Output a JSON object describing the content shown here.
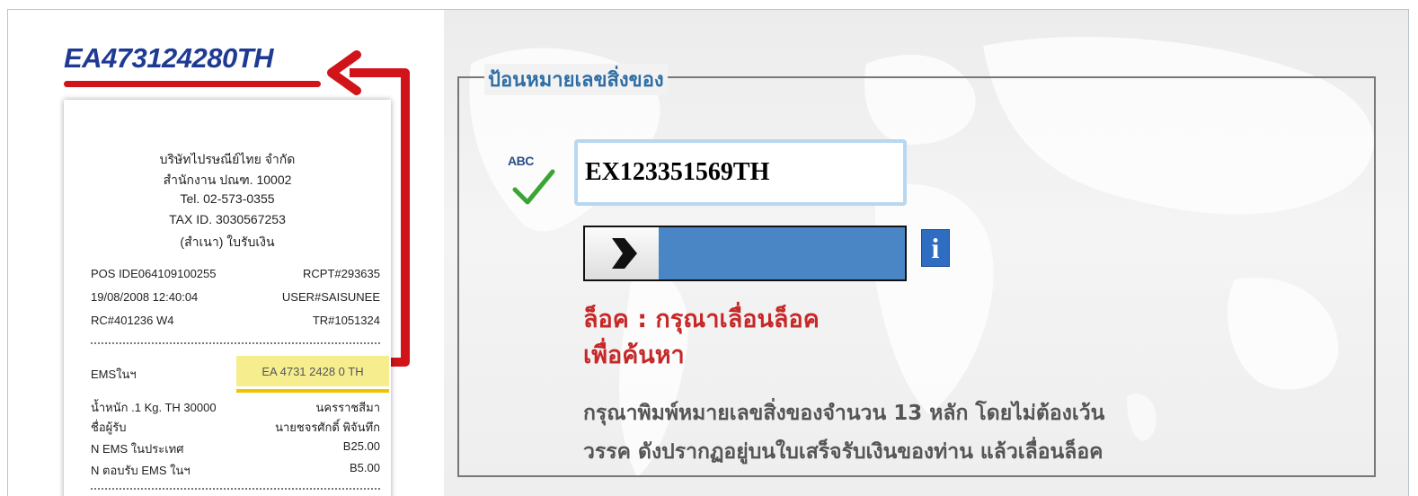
{
  "receipt_panel": {
    "tracking_heading": "EA473124280TH",
    "header_lines": [
      "บริษัทไปรษณีย์ไทย จำกัด",
      "สำนักงาน ปณฑ. 10002",
      "Tel. 02-573-0355",
      "TAX ID. 3030567253",
      "(สำเนา) ใบรับเงิน"
    ],
    "rows": [
      {
        "left": "POS IDE064109100255",
        "right": "RCPT#293635"
      },
      {
        "left": "19/08/2008  12:40:04",
        "right": "USER#SAISUNEE"
      },
      {
        "left": "RC#401236 W4",
        "right": "TR#1051324"
      }
    ],
    "service_label": "EMSในฯ",
    "tracking_highlight": "EA 4731 2428 0 TH",
    "detail_rows": [
      {
        "left": "น้ำหนัก .1 Kg. TH 30000",
        "right": "นครราชสีมา"
      },
      {
        "left": "ชื่อผู้รับ",
        "right": "นายชจรศักดิ์ พิจันทึก"
      },
      {
        "left": "N EMS ในประเทศ",
        "right": "B25.00"
      },
      {
        "left": "N ตอบรับ EMS ในฯ",
        "right": "B5.00"
      }
    ]
  },
  "form": {
    "legend": "ป้อนหมายเลขสิ่งของ",
    "abc_icon_label": "ABC",
    "tracking_input_value": "EX123351569TH",
    "lock_message_line1": "ล็อค : กรุณาเลื่อนล็อค",
    "lock_message_line2": "เพื่อค้นหา",
    "help_line1": "กรุณาพิมพ์หมายเลขสิ่งของจำนวน 13 หลัก โดยไม่ต้องเว้น",
    "help_line2": "วรรค ดังปรากฏอยู่บนใบเสร็จรับเงินของท่าน แล้วเลื่อนล็อค"
  },
  "colors": {
    "heading_blue": "#1f3a93",
    "accent_red": "#d0141a",
    "legend_blue": "#2f6ea5",
    "slider_blue": "#4a86c5",
    "lock_red": "#c62828",
    "highlight_yellow": "#f6ee8e"
  },
  "icons": [
    "abc-check-icon",
    "slider-arrow-icon",
    "info-icon",
    "red-pointer-arrow"
  ]
}
